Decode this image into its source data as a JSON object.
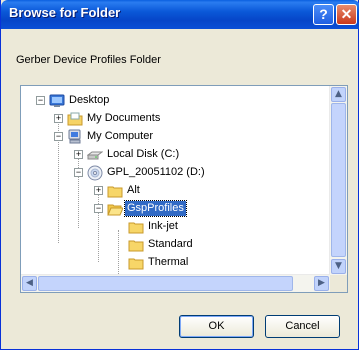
{
  "window": {
    "title": "Browse for Folder",
    "help_glyph": "?",
    "close_glyph": "✕"
  },
  "description": "Gerber Device Profiles Folder",
  "tree": [
    {
      "label": "Desktop",
      "icon": "desktop-icon",
      "toggle": "−"
    },
    {
      "label": "My Documents",
      "icon": "my-documents-icon",
      "toggle": "+"
    },
    {
      "label": "My Computer",
      "icon": "my-computer-icon",
      "toggle": "−"
    },
    {
      "label": "Local Disk (C:)",
      "icon": "local-disk-icon",
      "toggle": "+"
    },
    {
      "label": "GPL_20051102 (D:)",
      "icon": "cd-drive-icon",
      "toggle": "−"
    },
    {
      "label": "Alt",
      "icon": "folder-icon",
      "toggle": "+"
    },
    {
      "label": "GspProfiles",
      "icon": "folder-open-icon",
      "toggle": "−",
      "selected": true
    },
    {
      "label": "Ink-jet",
      "icon": "folder-icon"
    },
    {
      "label": "Standard",
      "icon": "folder-icon"
    },
    {
      "label": "Thermal",
      "icon": "folder-icon"
    }
  ],
  "scroll": {
    "up": "▲",
    "down": "▼",
    "left": "◀",
    "right": "▶"
  },
  "buttons": {
    "ok": "OK",
    "cancel": "Cancel"
  }
}
